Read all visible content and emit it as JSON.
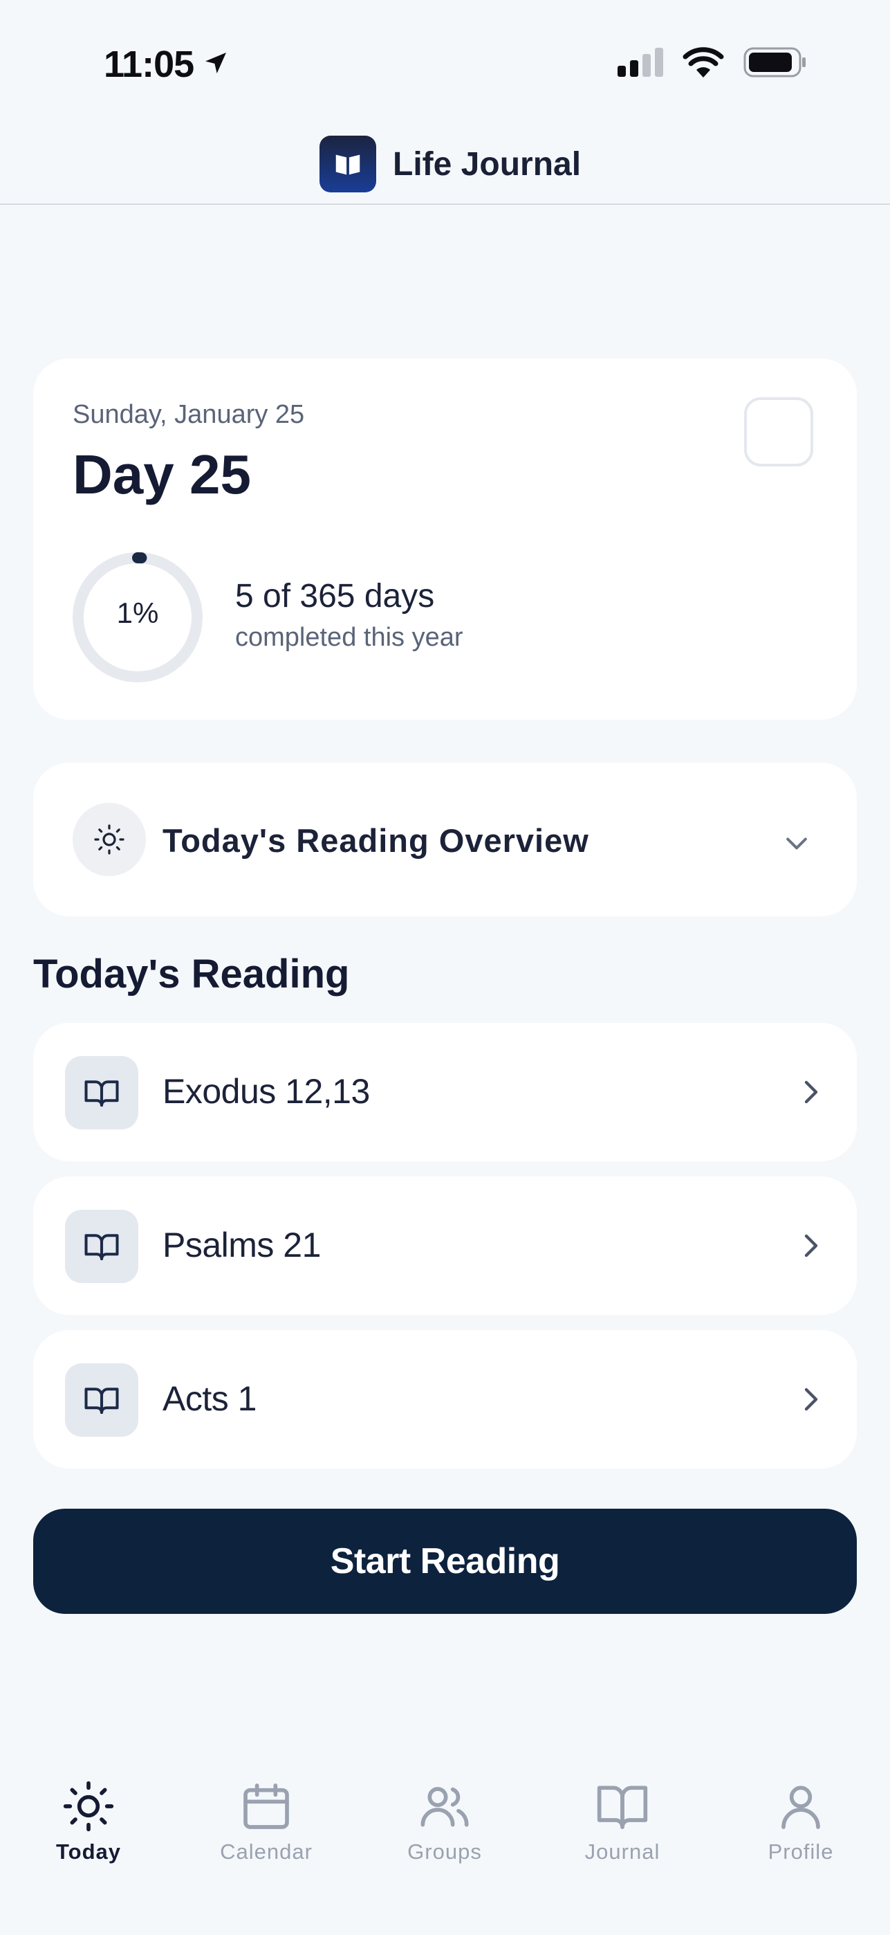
{
  "status_bar": {
    "time": "11:05"
  },
  "header": {
    "title": "Life Journal"
  },
  "day_card": {
    "date": "Sunday, January 25",
    "day_title": "Day 25",
    "progress_percent_label": "1%",
    "progress_fraction": 0.01,
    "days_completed": "5 of 365 days",
    "days_sub": "completed this year"
  },
  "overview": {
    "label": "Today's Reading Overview"
  },
  "reading": {
    "section_title": "Today's Reading",
    "items": [
      {
        "label": "Exodus 12,13"
      },
      {
        "label": "Psalms 21"
      },
      {
        "label": "Acts 1"
      }
    ]
  },
  "start_button": {
    "label": "Start Reading"
  },
  "tabs": [
    {
      "label": "Today",
      "icon": "sun-icon",
      "active": true
    },
    {
      "label": "Calendar",
      "icon": "calendar-icon",
      "active": false
    },
    {
      "label": "Groups",
      "icon": "users-icon",
      "active": false
    },
    {
      "label": "Journal",
      "icon": "book-open-icon",
      "active": false
    },
    {
      "label": "Profile",
      "icon": "user-icon",
      "active": false
    }
  ],
  "colors": {
    "background": "#f5f8fb",
    "primary_dark": "#0d223d",
    "text_primary": "#1c2238",
    "text_secondary": "#5a6478",
    "tab_inactive": "#9aa2b0"
  }
}
